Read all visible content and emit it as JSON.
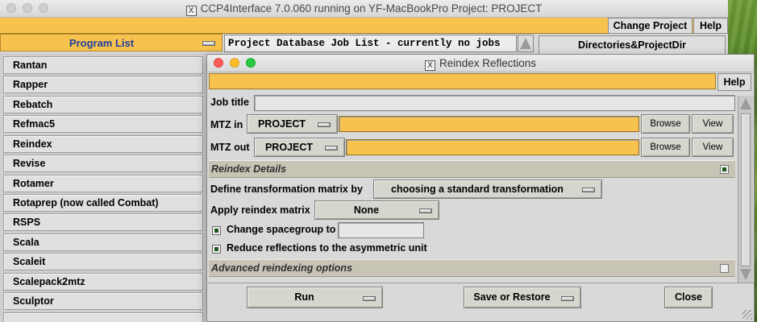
{
  "main_window": {
    "title": "CCP4Interface 7.0.060 running on YF-MacBookPro   Project: PROJECT",
    "title_icon": "x11-icon",
    "menu": {
      "change_project": "Change Project",
      "help": "Help"
    }
  },
  "program_list": {
    "header": "Program List",
    "items": [
      "Rantan",
      "Rapper",
      "Rebatch",
      "Refmac5",
      "Reindex",
      "Revise",
      "Rotamer",
      "Rotaprep (now called Combat)",
      "RSPS",
      "Scala",
      "Scaleit",
      "Scalepack2mtz",
      "Sculptor"
    ]
  },
  "project_db": {
    "label": "Project Database Job List - currently no jobs",
    "directories_button": "Directories&ProjectDir"
  },
  "dialog": {
    "title": "Reindex Reflections",
    "title_icon": "x11-icon",
    "help": "Help",
    "job_title": {
      "label": "Job title",
      "value": ""
    },
    "mtz_in": {
      "label": "MTZ in",
      "project": "PROJECT",
      "value": "",
      "browse": "Browse",
      "view": "View"
    },
    "mtz_out": {
      "label": "MTZ out",
      "project": "PROJECT",
      "value": "",
      "browse": "Browse",
      "view": "View"
    },
    "reindex_details": {
      "title": "Reindex Details",
      "expanded": true,
      "define_matrix_label": "Define transformation matrix by",
      "define_matrix_value": "choosing a standard transformation",
      "apply_matrix_label": "Apply reindex matrix",
      "apply_matrix_value": "None",
      "change_spacegroup_label": "Change spacegroup to",
      "change_spacegroup_checked": true,
      "change_spacegroup_value": "",
      "reduce_label": "Reduce reflections to the asymmetric unit",
      "reduce_checked": true
    },
    "advanced": {
      "title": "Advanced reindexing options",
      "expanded": false
    },
    "buttons": {
      "run": "Run",
      "save_restore": "Save or Restore",
      "close": "Close"
    }
  },
  "colors": {
    "accent_orange": "#f8c24e",
    "program_header_text": "#1c3fa0",
    "section_bg": "#c7c4b6",
    "button_bg": "#d6d6ce"
  }
}
